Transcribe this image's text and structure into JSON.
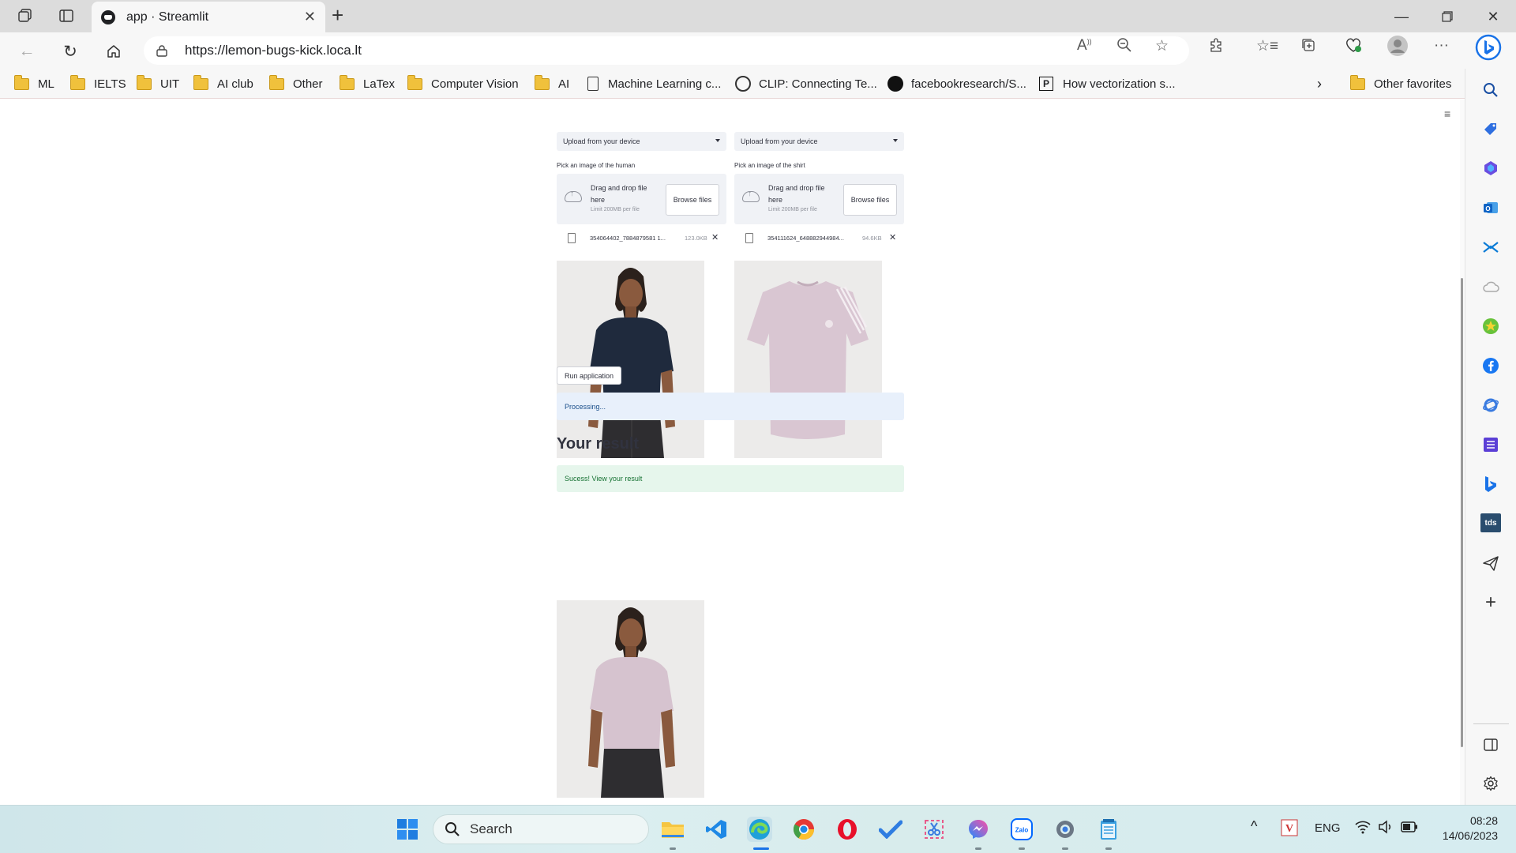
{
  "browser": {
    "tab_title": "app · Streamlit",
    "url": "https://lemon-bugs-kick.loca.lt",
    "favorites": [
      {
        "label": "ML",
        "type": "folder"
      },
      {
        "label": "IELTS",
        "type": "folder"
      },
      {
        "label": "UIT",
        "type": "folder"
      },
      {
        "label": "AI club",
        "type": "folder"
      },
      {
        "label": "Other",
        "type": "folder"
      },
      {
        "label": "LaTex",
        "type": "folder"
      },
      {
        "label": "Computer Vision",
        "type": "folder"
      },
      {
        "label": "AI",
        "type": "folder"
      },
      {
        "label": "Machine Learning c...",
        "type": "page"
      },
      {
        "label": "CLIP: Connecting Te...",
        "type": "openai"
      },
      {
        "label": "facebookresearch/S...",
        "type": "github"
      },
      {
        "label": "How vectorization s...",
        "type": "p"
      }
    ],
    "other_favorites": "Other favorites"
  },
  "app": {
    "left": {
      "select": "Upload from your device",
      "label": "Pick an image of the human",
      "drop_title": "Drag and drop file here",
      "drop_limit": "Limit 200MB per file",
      "browse": "Browse files",
      "file_name": "354064402_7884879581 1...",
      "file_size": "123.0KB"
    },
    "right": {
      "select": "Upload from your device",
      "label": "Pick an image of the shirt",
      "drop_title": "Drag and drop file here",
      "drop_limit": "Limit 200MB per file",
      "browse": "Browse files",
      "file_name": "354111624_648882944984...",
      "file_size": "94.6KB"
    },
    "run_button": "Run application",
    "processing": "Processing...",
    "result_title": "Your result",
    "success": "Sucess! View your result"
  },
  "taskbar": {
    "search_label": "Search",
    "lang": "ENG",
    "time": "08:28",
    "date": "14/06/2023"
  },
  "colors": {
    "navy_shirt": "#1f2a3d",
    "pink_shirt": "#d9c6d2",
    "info_bg": "#e8f0fb",
    "success_bg": "#e6f6ec"
  }
}
